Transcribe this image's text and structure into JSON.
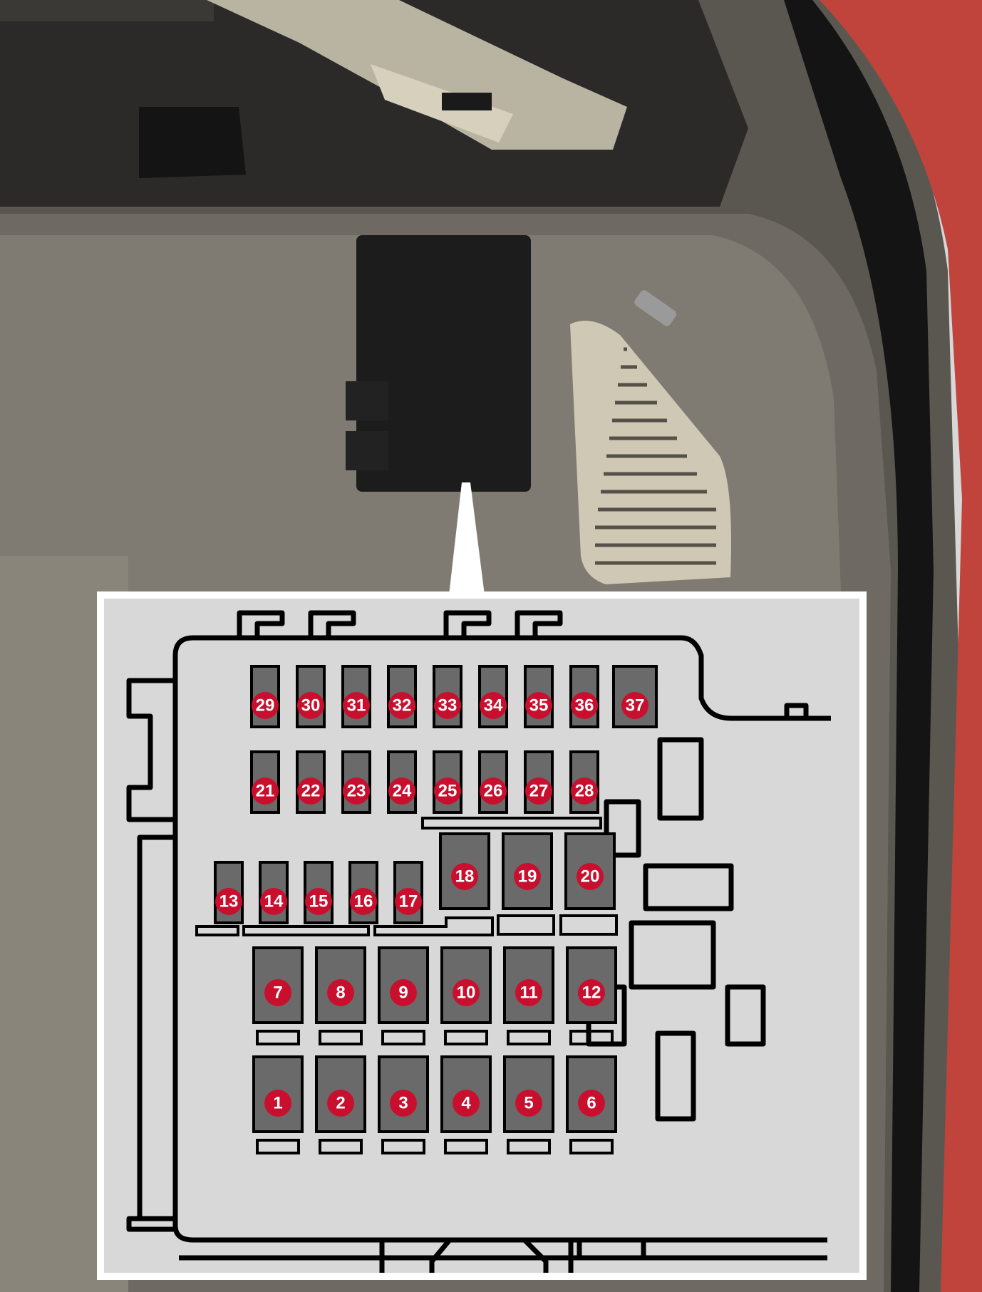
{
  "colors": {
    "badge": "#c8102e",
    "fuse_fill": "#6a6a6a",
    "outline": "#000000",
    "panel_bg": "#d8d8d8",
    "trunk_panel": "#6e6a63",
    "fusebox_shadow": "#1c1c1c"
  },
  "fuses": {
    "row_top": [
      "29",
      "30",
      "31",
      "32",
      "33",
      "34",
      "35",
      "36",
      "37"
    ],
    "row_second": [
      "21",
      "22",
      "23",
      "24",
      "25",
      "26",
      "27",
      "28"
    ],
    "row_small": [
      "13",
      "14",
      "15",
      "16",
      "17"
    ],
    "row_medium": [
      "18",
      "19",
      "20"
    ],
    "row_large_upper": [
      "7",
      "8",
      "9",
      "10",
      "11",
      "12"
    ],
    "row_large_lower": [
      "1",
      "2",
      "3",
      "4",
      "5",
      "6"
    ]
  }
}
